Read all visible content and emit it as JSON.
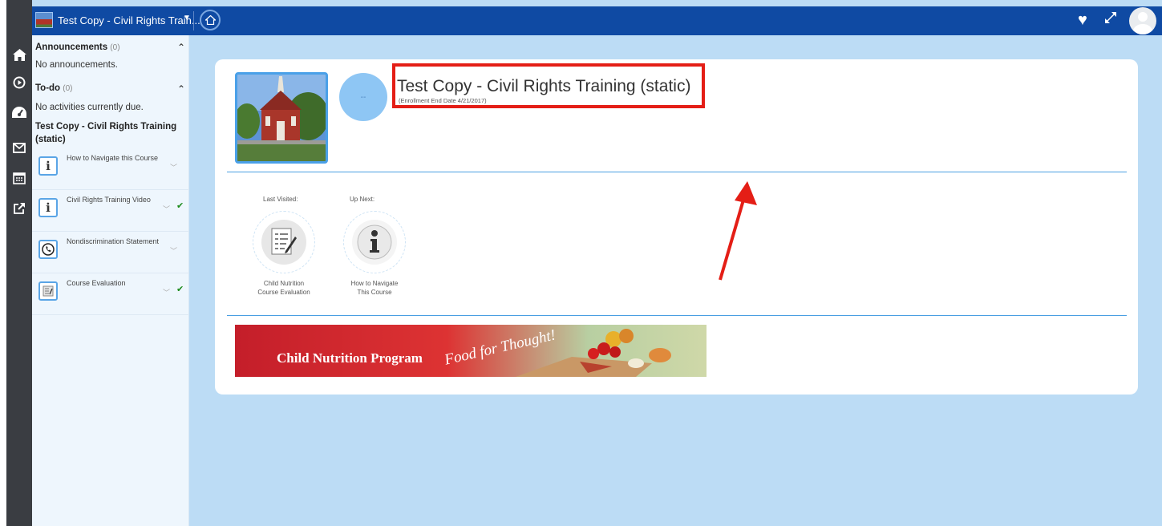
{
  "topbar": {
    "menu_icon": "hamburger-icon",
    "course_title": "Test Copy - Civil Rights Train...",
    "dropdown_icon": "caret-down-icon",
    "home_icon": "home-icon",
    "favorite_icon": "heart-icon",
    "expand_icon": "expand-icon",
    "avatar_icon": "user-avatar-icon"
  },
  "rail": {
    "icons": [
      "home-icon",
      "play-circle-icon",
      "dashboard-icon",
      "mail-icon",
      "calendar-icon",
      "external-link-icon"
    ]
  },
  "sidebar": {
    "announcements": {
      "title": "Announcements",
      "count": "(0)",
      "empty_text": "No announcements."
    },
    "todo": {
      "title": "To-do",
      "count": "(0)",
      "empty_text": "No activities currently due."
    },
    "course_heading_line1": "Test Copy - Civil Rights Training",
    "course_heading_line2": "(static)",
    "activities": [
      {
        "label": "How to Navigate this Course",
        "icon": "info-icon",
        "completed": false
      },
      {
        "label": "Civil Rights Training Video",
        "icon": "info-icon",
        "completed": true
      },
      {
        "label": "Nondiscrimination Statement",
        "icon": "phone-icon",
        "completed": false
      },
      {
        "label": "Course Evaluation",
        "icon": "form-icon",
        "completed": true
      }
    ]
  },
  "main": {
    "progress_text": "--",
    "course_title": "Test Copy - Civil Rights Training (static)",
    "enrollment_end": "(Enrollment End Date 4/21/2017)",
    "last_visited": {
      "heading": "Last Visited:",
      "line1": "Child Nutrition",
      "line2": "Course Evaluation",
      "icon": "checklist-icon"
    },
    "up_next": {
      "heading": "Up Next:",
      "line1": "How to Navigate",
      "line2": "This Course",
      "icon": "info-icon"
    },
    "banner": {
      "text_main": "Child Nutrition Program",
      "text_script": "Food for Thought!"
    }
  },
  "colors": {
    "topbar": "#0f4aa3",
    "rail": "#3a3d42",
    "background": "#bcdcf5",
    "highlight": "#e41e16",
    "accent": "#4a9fe2"
  }
}
